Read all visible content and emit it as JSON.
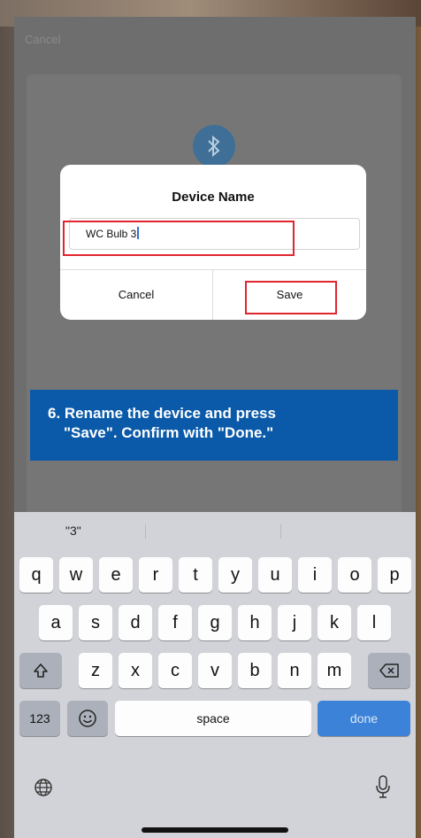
{
  "screen": {
    "top_cancel": "Cancel"
  },
  "dialog": {
    "title": "Device Name",
    "field_value": "WC Bulb 3",
    "cancel_label": "Cancel",
    "save_label": "Save"
  },
  "instruction": {
    "line1": "6.  Rename the device and press",
    "line2": "\"Save\". Confirm with \"Done.\""
  },
  "keyboard": {
    "suggestion": "\"3\"",
    "row1": [
      "q",
      "w",
      "e",
      "r",
      "t",
      "y",
      "u",
      "i",
      "o",
      "p"
    ],
    "row2": [
      "a",
      "s",
      "d",
      "f",
      "g",
      "h",
      "j",
      "k",
      "l"
    ],
    "row3": [
      "z",
      "x",
      "c",
      "v",
      "b",
      "n",
      "m"
    ],
    "numbers_label": "123",
    "space_label": "space",
    "done_label": "done"
  },
  "icons": {
    "bluetooth": "bluetooth-icon",
    "shift": "shift-icon",
    "backspace": "backspace-icon",
    "emoji": "emoji-icon",
    "globe": "globe-icon",
    "microphone": "microphone-icon"
  },
  "colors": {
    "highlight_box": "#e0252e",
    "instruction_banner": "#0b5aa9",
    "done_key": "#3b82d8"
  }
}
